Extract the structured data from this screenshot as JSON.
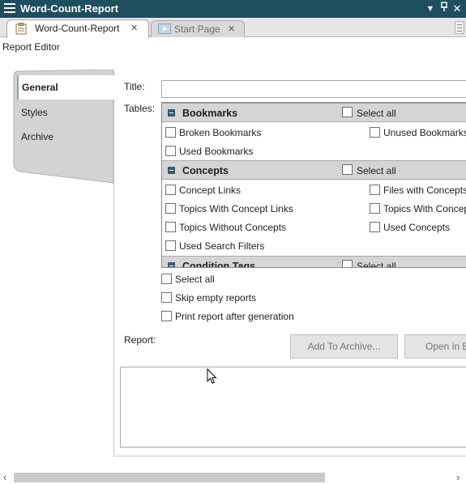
{
  "window": {
    "title": "Word-Count-Report",
    "controls": [
      "chevron-down-icon",
      "pin-icon",
      "close-icon"
    ]
  },
  "tabs": [
    {
      "label": "Word-Count-Report",
      "icon": "report-icon",
      "active": true
    },
    {
      "label": "Start Page",
      "icon": "start-page-icon",
      "active": false
    }
  ],
  "editor_label": "Report Editor",
  "side_tabs": [
    {
      "label": "General",
      "selected": true
    },
    {
      "label": "Styles",
      "selected": false
    },
    {
      "label": "Archive",
      "selected": false
    }
  ],
  "form": {
    "title_label": "Title:",
    "title_value": "",
    "tables_label": "Tables:",
    "report_label": "Report:"
  },
  "groups": [
    {
      "name": "Bookmarks",
      "select_all": "Select all",
      "items": [
        {
          "label": "Broken Bookmarks",
          "checked": false
        },
        {
          "label": "Unused Bookmarks",
          "checked": false
        },
        {
          "label": "Used Bookmarks",
          "checked": false
        }
      ]
    },
    {
      "name": "Concepts",
      "select_all": "Select all",
      "items": [
        {
          "label": "Concept Links",
          "checked": false
        },
        {
          "label": "Files with Concepts",
          "checked": false
        },
        {
          "label": "Topics With Concept Links",
          "checked": false
        },
        {
          "label": "Topics With Concept L",
          "checked": false
        },
        {
          "label": "Topics Without Concepts",
          "checked": false
        },
        {
          "label": "Used Concepts",
          "checked": false
        },
        {
          "label": "Used Search Filters",
          "checked": false
        }
      ]
    },
    {
      "name": "Condition Tags",
      "select_all": "Select all",
      "items": []
    }
  ],
  "options": [
    {
      "label": "Select all",
      "checked": false
    },
    {
      "label": "Skip empty reports",
      "checked": false
    },
    {
      "label": "Print report after generation",
      "checked": false
    }
  ],
  "buttons": {
    "add_to_archive": "Add To Archive...",
    "open_in_browser": "Open in Br"
  },
  "colors": {
    "titlebar": "#1f4e5f",
    "group_header": "#d5d5d5",
    "collapse_icon": "#3c5a6b"
  }
}
